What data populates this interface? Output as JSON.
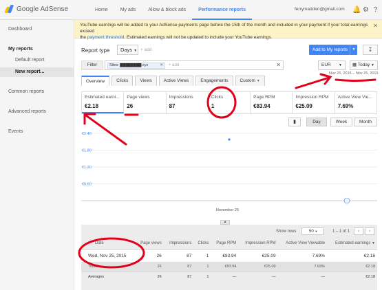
{
  "app": {
    "brand": "Google AdSense",
    "nav": [
      "Home",
      "My ads",
      "Allow & block ads",
      "Performance reports"
    ],
    "account": "ferrymadden@gmail.com"
  },
  "sidebar": {
    "dashboard": "Dashboard",
    "my_reports": "My reports",
    "default_report": "Default report",
    "new_report": "New report...",
    "common_reports": "Common reports",
    "advanced_reports": "Advanced reports",
    "events": "Events"
  },
  "banner": {
    "line1": "YouTube earnings will be added to your AdSense payments page before the 15th of the month and included in your payment if your total earnings exceed",
    "line2_pre": "the",
    "link": "payment threshold",
    "line2_post": ". Estimated earnings will not be updated to include your YouTube earnings."
  },
  "report": {
    "type_label": "Report type",
    "period": "Days",
    "add": "+ add",
    "add_to_my_reports": "Add to My reports",
    "filter_label": "Filter",
    "filter_chip": "Sites: ████████.xyz",
    "filter_add": "+ add",
    "currency": "EUR",
    "date_preset": "Today",
    "date_range": "Nov 25, 2015 – Nov 25, 2015"
  },
  "tabs": [
    "Overview",
    "Clicks",
    "Views",
    "Active Views",
    "Engagements",
    "Custom"
  ],
  "metrics": [
    {
      "label": "Estimated earni...",
      "value": "€2.18"
    },
    {
      "label": "Page views",
      "value": "26"
    },
    {
      "label": "Impressions",
      "value": "87"
    },
    {
      "label": "Clicks",
      "value": "1"
    },
    {
      "label": "Page RPM",
      "value": "€83.94"
    },
    {
      "label": "Impression RPM",
      "value": "€25.09"
    },
    {
      "label": "Active View Vie...",
      "value": "7.69%"
    }
  ],
  "chart_controls": {
    "day": "Day",
    "week": "Week",
    "month": "Month"
  },
  "chart_data": {
    "type": "line",
    "x": [
      "November 25"
    ],
    "series": [
      {
        "values": [
          2.18
        ]
      }
    ],
    "ytick_labels": [
      "€2.40",
      "€1.80",
      "€1.20",
      "€0.60"
    ],
    "ylim": [
      0,
      2.4
    ],
    "grid": true,
    "color": "#4285f4"
  },
  "table": {
    "show_rows_label": "Show rows",
    "rows_value": "50",
    "pager_text": "1 – 1 of 1",
    "headers": [
      "Date",
      "Page views",
      "Impressions",
      "Clicks",
      "Page RPM",
      "Impression RPM",
      "Active View Viewable",
      "Estimated earnings"
    ],
    "rows": [
      [
        "Wed, Nov 25, 2015",
        "26",
        "87",
        "1",
        "€83.94",
        "€25.09",
        "7.69%",
        "€2.18"
      ]
    ],
    "totals": [
      "Totals",
      "26",
      "87",
      "1",
      "€83.94",
      "€25.09",
      "7.69%",
      "€2.18"
    ],
    "averages": [
      "Averages",
      "26",
      "87",
      "1",
      "—",
      "—",
      "—",
      "€2.18"
    ]
  },
  "annotation_color": "#e3001b"
}
